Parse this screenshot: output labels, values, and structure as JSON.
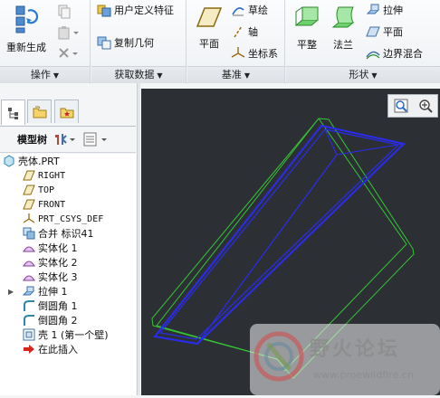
{
  "ribbon": {
    "groups": {
      "operations": {
        "label": "操作",
        "regenerate_label": "重新生成"
      },
      "get_data": {
        "label": "获取数据",
        "udf_label": "用户定义特征",
        "copy_geom_label": "复制几何"
      },
      "datum": {
        "label": "基准",
        "plane_label": "平面",
        "sketch_label": "草绘",
        "axis_label": "轴",
        "csys_label": "坐标系"
      },
      "shapes": {
        "label": "形状",
        "flat_label": "平整",
        "flange_label": "法兰",
        "extrude_label": "拉伸",
        "plane_label": "平面",
        "blend_label": "边界混合"
      }
    }
  },
  "model_tree": {
    "title": "模型树",
    "items": [
      {
        "label": "壳体.PRT",
        "icon": "part-icon"
      },
      {
        "label": "RIGHT",
        "icon": "datum-plane-icon"
      },
      {
        "label": "TOP",
        "icon": "datum-plane-icon"
      },
      {
        "label": "FRONT",
        "icon": "datum-plane-icon"
      },
      {
        "label": "PRT_CSYS_DEF",
        "icon": "csys-icon"
      },
      {
        "label": "合并 标识41",
        "icon": "merge-icon"
      },
      {
        "label": "实体化 1",
        "icon": "solidify-icon"
      },
      {
        "label": "实体化 2",
        "icon": "solidify-icon"
      },
      {
        "label": "实体化 3",
        "icon": "solidify-icon"
      },
      {
        "label": "拉伸 1",
        "icon": "extrude-icon"
      },
      {
        "label": "倒圆角 1",
        "icon": "round-icon"
      },
      {
        "label": "倒圆角 2",
        "icon": "round-icon"
      },
      {
        "label": "壳 1 (第一个壁)",
        "icon": "shell-icon"
      },
      {
        "label": "在此插入",
        "icon": "insert-arrow-icon"
      }
    ]
  },
  "watermark": {
    "text": "野火论坛",
    "url": "www.proewildfire.cn"
  },
  "colors": {
    "viewport_bg": "#2c3035",
    "model_edge_green": "#36c436",
    "model_edge_blue": "#2b2bf0"
  }
}
